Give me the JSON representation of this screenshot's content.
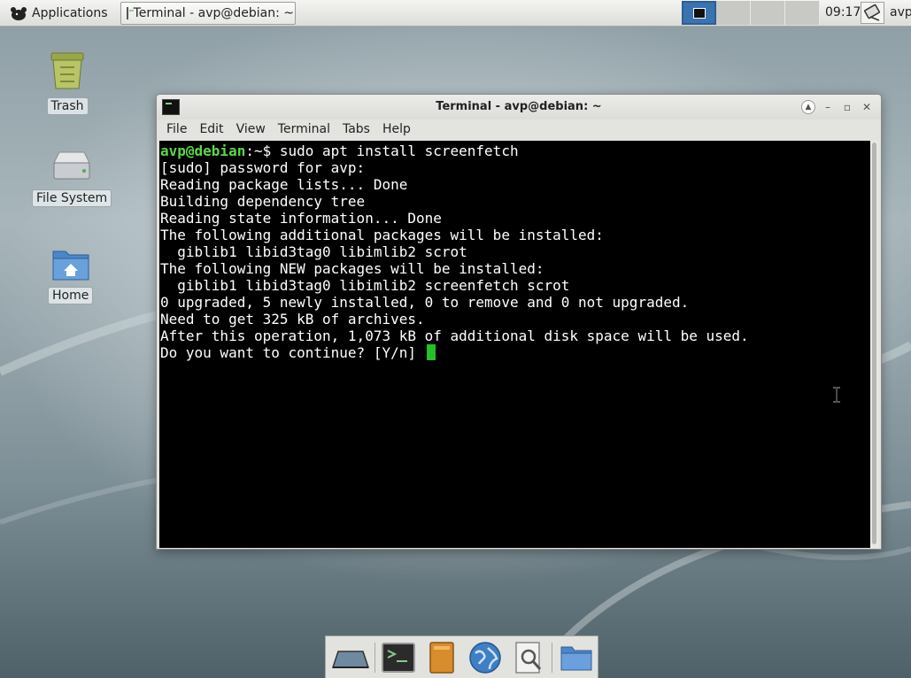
{
  "top_panel": {
    "applications_label": "Applications",
    "task_label": "Terminal - avp@debian: ~",
    "clock": "09:17",
    "user": "avp"
  },
  "desktop": {
    "icons": [
      {
        "label": "Trash",
        "icon": "trash-icon"
      },
      {
        "label": "File System",
        "icon": "drive-icon"
      },
      {
        "label": "Home",
        "icon": "home-folder-icon"
      }
    ]
  },
  "window": {
    "title": "Terminal - avp@debian: ~",
    "menu": [
      "File",
      "Edit",
      "View",
      "Terminal",
      "Tabs",
      "Help"
    ]
  },
  "terminal": {
    "prompt": "avp@debian",
    "prompt_suffix": ":~$ ",
    "command": "sudo apt install screenfetch",
    "lines": [
      "[sudo] password for avp:",
      "Reading package lists... Done",
      "Building dependency tree",
      "Reading state information... Done",
      "The following additional packages will be installed:",
      "  giblib1 libid3tag0 libimlib2 scrot",
      "The following NEW packages will be installed:",
      "  giblib1 libid3tag0 libimlib2 screenfetch scrot",
      "0 upgraded, 5 newly installed, 0 to remove and 0 not upgraded.",
      "Need to get 325 kB of archives.",
      "After this operation, 1,073 kB of additional disk space will be used."
    ],
    "last_line": "Do you want to continue? [Y/n] "
  },
  "dock": {
    "launchers": [
      "show-desktop-icon",
      "terminal-icon",
      "file-manager-icon",
      "web-browser-icon",
      "app-finder-icon",
      "folder-icon"
    ]
  },
  "colors": {
    "prompt_green": "#5ad84a",
    "cursor_green": "#22c02a",
    "workspace_active": "#3a73b0"
  }
}
